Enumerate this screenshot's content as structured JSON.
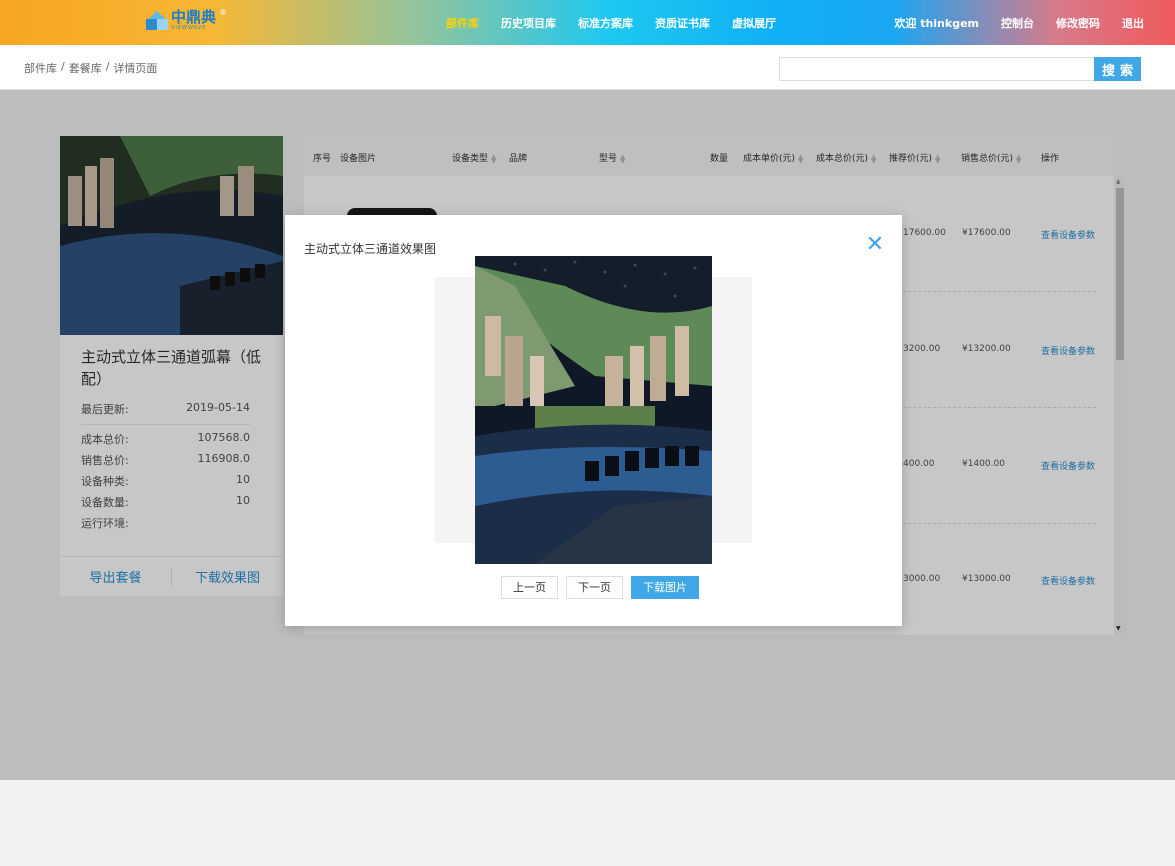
{
  "header": {
    "logo_text": "中鼎典",
    "logo_sub": "VIEWWAVE",
    "logo_mark": "®",
    "nav": [
      "部件库",
      "历史项目库",
      "标准方案库",
      "资质证书库",
      "虚拟展厅"
    ],
    "active_nav": 0,
    "user": [
      "欢迎 thinkgem",
      "控制台",
      "修改密码",
      "退出"
    ]
  },
  "breadcrumb": [
    "部件库",
    "套餐库",
    "详情页面"
  ],
  "breadcrumb_sep": "/",
  "search": {
    "placeholder": "",
    "button": "搜索"
  },
  "card": {
    "title": "主动式立体三通道弧幕（低配）",
    "updated_label": "最后更新:",
    "updated_value": "2019-05-14",
    "rows": [
      {
        "label": "成本总价:",
        "value": "107568.0"
      },
      {
        "label": "销售总价:",
        "value": "116908.0"
      },
      {
        "label": "设备种类:",
        "value": "10"
      },
      {
        "label": "设备数量:",
        "value": "10"
      },
      {
        "label": "运行环境:",
        "value": ""
      }
    ],
    "actions": [
      "导出套餐",
      "下载效果图"
    ]
  },
  "table": {
    "headers": [
      "序号",
      "设备图片",
      "设备类型",
      "品牌",
      "型号",
      "数量",
      "成本单价(元)",
      "成本总价(元)",
      "推荐价(元)",
      "销售总价(元)",
      "操作"
    ],
    "rows": [
      {
        "recommend": "17600.00",
        "sale": "¥17600.00",
        "action": "查看设备参数"
      },
      {
        "recommend": "3200.00",
        "sale": "¥13200.00",
        "action": "查看设备参数"
      },
      {
        "recommend": "400.00",
        "sale": "¥1400.00",
        "action": "查看设备参数"
      },
      {
        "recommend": "3000.00",
        "sale": "¥13000.00",
        "action": "查看设备参数"
      }
    ]
  },
  "modal": {
    "title": "主动式立体三通道效果图",
    "buttons": [
      "上一页",
      "下一页",
      "下载图片"
    ]
  },
  "colors": {
    "accent": "#3fa7e6",
    "link": "#2b8fd0",
    "active_nav": "#ffd200"
  }
}
